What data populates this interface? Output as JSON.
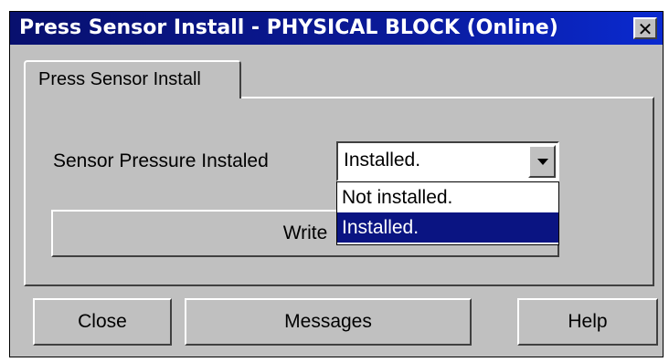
{
  "window": {
    "title": "Press Sensor Install - PHYSICAL BLOCK  (Online)",
    "close_glyph": "✕"
  },
  "tab": {
    "label": "Press Sensor Install"
  },
  "form": {
    "sensor_label": "Sensor Pressure Instaled",
    "select_value": "Installed.",
    "options": [
      "Not installed.",
      "Installed."
    ],
    "selected_index": 1,
    "write_label": "Write"
  },
  "footer": {
    "close_label": "Close",
    "messages_label": "Messages",
    "help_label": "Help"
  },
  "colors": {
    "title_bar": "#0a1a9a",
    "selection": "#0a1482",
    "face": "#c0c0c0"
  }
}
